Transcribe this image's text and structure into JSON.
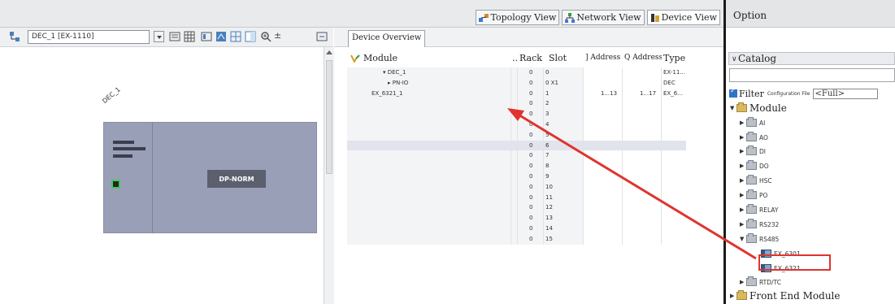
{
  "view_tabs": [
    {
      "label": "Topology View",
      "icon": "topology-icon"
    },
    {
      "label": "Network View",
      "icon": "network-icon"
    },
    {
      "label": "Device View",
      "icon": "device-view-icon"
    }
  ],
  "editor": {
    "device_select": "DEC_1 [EX-1110]",
    "zoom_toggle": "±",
    "device_label": "DEC_1",
    "dp_norm": "DP-NORM"
  },
  "overview": {
    "tab_label": "Device Overview",
    "columns": {
      "module": "Module",
      "more": "...",
      "rack": "Rack",
      "slot": "Slot",
      "iaddr": "] Address",
      "qaddr": "Q Address",
      "type": "Type"
    },
    "rows": [
      {
        "module": "▾ DEC_1",
        "rack": "0",
        "slot": "0",
        "iaddr": "",
        "qaddr": "",
        "type": "EX-11..."
      },
      {
        "module": "▸ PN-IO",
        "rack": "0",
        "slot": "0 X1",
        "iaddr": "",
        "qaddr": "",
        "type": "DEC"
      },
      {
        "module": "EX_6321_1",
        "rack": "0",
        "slot": "1",
        "iaddr": "1...13",
        "qaddr": "1...17",
        "type": "EX_6..."
      },
      {
        "module": "",
        "rack": "0",
        "slot": "2",
        "iaddr": "",
        "qaddr": "",
        "type": ""
      },
      {
        "module": "",
        "rack": "0",
        "slot": "3",
        "iaddr": "",
        "qaddr": "",
        "type": ""
      },
      {
        "module": "",
        "rack": "0",
        "slot": "4",
        "iaddr": "",
        "qaddr": "",
        "type": ""
      },
      {
        "module": "",
        "rack": "0",
        "slot": "5",
        "iaddr": "",
        "qaddr": "",
        "type": ""
      },
      {
        "module": "",
        "rack": "0",
        "slot": "6",
        "iaddr": "",
        "qaddr": "",
        "type": ""
      },
      {
        "module": "",
        "rack": "0",
        "slot": "7",
        "iaddr": "",
        "qaddr": "",
        "type": ""
      },
      {
        "module": "",
        "rack": "0",
        "slot": "8",
        "iaddr": "",
        "qaddr": "",
        "type": ""
      },
      {
        "module": "",
        "rack": "0",
        "slot": "9",
        "iaddr": "",
        "qaddr": "",
        "type": ""
      },
      {
        "module": "",
        "rack": "0",
        "slot": "10",
        "iaddr": "",
        "qaddr": "",
        "type": ""
      },
      {
        "module": "",
        "rack": "0",
        "slot": "11",
        "iaddr": "",
        "qaddr": "",
        "type": ""
      },
      {
        "module": "",
        "rack": "0",
        "slot": "12",
        "iaddr": "",
        "qaddr": "",
        "type": ""
      },
      {
        "module": "",
        "rack": "0",
        "slot": "13",
        "iaddr": "",
        "qaddr": "",
        "type": ""
      },
      {
        "module": "",
        "rack": "0",
        "slot": "14",
        "iaddr": "",
        "qaddr": "",
        "type": ""
      },
      {
        "module": "",
        "rack": "0",
        "slot": "15",
        "iaddr": "",
        "qaddr": "",
        "type": ""
      }
    ],
    "selected_row": 7
  },
  "catalog": {
    "option_title": "Option",
    "title": "Catalog",
    "search_value": "",
    "filter_label": "Filter",
    "config_label": "Configuration File",
    "config_value": "<Full>",
    "tree": [
      {
        "label": "Module",
        "kind": "folder",
        "expanded": true,
        "big": true
      },
      {
        "label": "AI",
        "kind": "folder-gray"
      },
      {
        "label": "AO",
        "kind": "folder-gray"
      },
      {
        "label": "DI",
        "kind": "folder-gray"
      },
      {
        "label": "DO",
        "kind": "folder-gray"
      },
      {
        "label": "HSC",
        "kind": "folder-gray"
      },
      {
        "label": "PO",
        "kind": "folder-gray"
      },
      {
        "label": "RELAY",
        "kind": "folder-gray"
      },
      {
        "label": "RS232",
        "kind": "folder-gray"
      },
      {
        "label": "RS485",
        "kind": "folder-gray",
        "expanded": true
      },
      {
        "label": "EX_6301",
        "kind": "module"
      },
      {
        "label": "EX_6321",
        "kind": "module",
        "highlighted": true
      },
      {
        "label": "RTD/TC",
        "kind": "folder-gray"
      },
      {
        "label": "Front End Module",
        "kind": "folder",
        "big": true
      }
    ]
  },
  "colors": {
    "annotation": "#e0332e",
    "device_body": "#9a9fb8",
    "selection": "#2f74c8"
  }
}
